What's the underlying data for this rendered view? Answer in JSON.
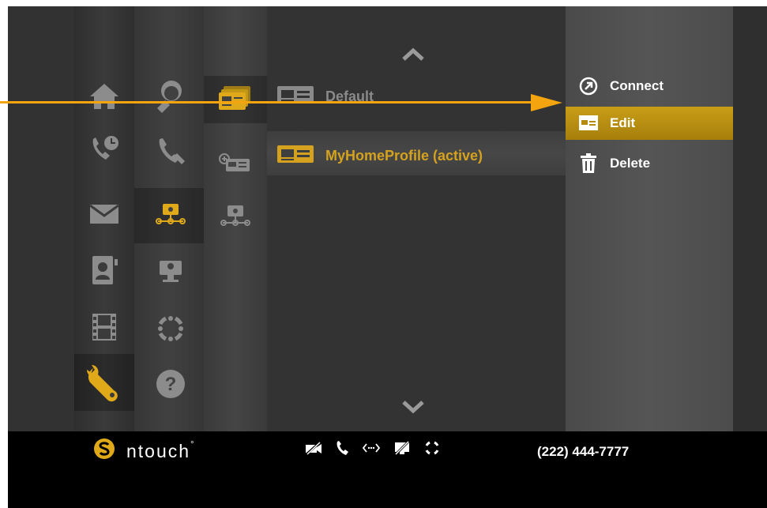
{
  "profiles": [
    {
      "name": "Default",
      "active": false
    },
    {
      "name": "MyHomeProfile (active)",
      "active": true
    }
  ],
  "menu": {
    "connect": "Connect",
    "edit": "Edit",
    "delete": "Delete"
  },
  "footer": {
    "brand": "ntouch",
    "brand_mark": "°",
    "phone": "(222) 444-7777"
  },
  "colors": {
    "accent": "#d4a21e",
    "background": "#323232",
    "footer": "#000000",
    "callout_arrow": "#f4a40f"
  },
  "icons": {
    "main_nav": [
      "home-icon",
      "call-history-icon",
      "mail-icon",
      "contacts-icon",
      "video-icon",
      "settings-icon"
    ],
    "settings_nav": [
      "personal-info-icon",
      "audio-settings-icon",
      "network-icon",
      "video-settings-icon",
      "camera-ring-icon",
      "help-icon"
    ],
    "network_nav": [
      "profiles-icon",
      "add-profile-icon",
      "network-settings-icon"
    ],
    "status_bar": [
      "video-off-icon",
      "phone-icon",
      "network-activity-icon",
      "camera-off-icon",
      "signal-ring-icon"
    ]
  }
}
